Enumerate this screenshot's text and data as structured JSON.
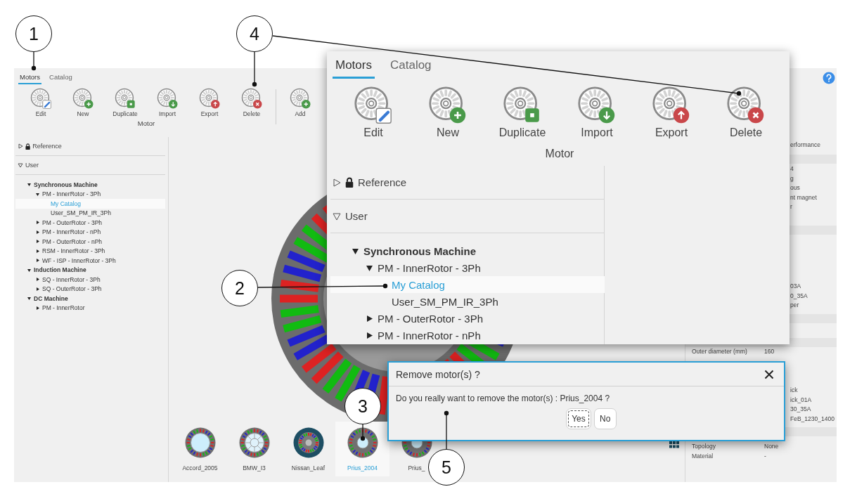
{
  "app": {
    "tabs": [
      {
        "label": "Motors",
        "selected": true
      },
      {
        "label": "Catalog",
        "selected": false
      }
    ],
    "toolbar": [
      {
        "label": "Motor",
        "buttons": [
          {
            "label": "Edit",
            "kind": "edit"
          },
          {
            "label": "New",
            "kind": "new"
          },
          {
            "label": "Duplicate",
            "kind": "duplicate"
          },
          {
            "label": "Import",
            "kind": "import"
          },
          {
            "label": "Export",
            "kind": "export"
          },
          {
            "label": "Delete",
            "kind": "delete"
          }
        ]
      },
      {
        "buttons": [
          {
            "label": "Add",
            "kind": "add"
          }
        ]
      }
    ],
    "tree": [
      {
        "label": "Reference",
        "locked": true,
        "expanded": false
      },
      {
        "label": "User",
        "locked": false,
        "expanded": true,
        "children": [
          {
            "label": "Synchronous Machine",
            "kind": "folder",
            "expanded": true,
            "selected": false,
            "children": [
              {
                "label": "PM - InnerRotor - 3Ph",
                "kind": "folder",
                "expanded": true,
                "selected": false,
                "children": [
                  {
                    "label": "My Catalog",
                    "kind": "leaf",
                    "selected": true
                  },
                  {
                    "label": "User_SM_PM_IR_3Ph",
                    "kind": "leaf",
                    "selected": false
                  }
                ]
              },
              {
                "label": "PM - OuterRotor - 3Ph",
                "kind": "folder",
                "expanded": false,
                "selected": false
              },
              {
                "label": "PM - InnerRotor - nPh",
                "kind": "folder",
                "expanded": false,
                "selected": false
              },
              {
                "label": "PM - OuterRotor - nPh",
                "kind": "folder",
                "expanded": false,
                "selected": false
              },
              {
                "label": "RSM - InnerRotor - 3Ph",
                "kind": "folder",
                "expanded": false,
                "selected": false
              },
              {
                "label": "WF - ISP - InnerRotor - 3Ph",
                "kind": "folder",
                "expanded": false,
                "selected": false
              }
            ]
          },
          {
            "label": "Induction Machine",
            "kind": "folder",
            "expanded": true,
            "selected": false,
            "children": [
              {
                "label": "SQ - InnerRotor - 3Ph",
                "kind": "folder",
                "expanded": false,
                "selected": false
              },
              {
                "label": "SQ - OuterRotor - 3Ph",
                "kind": "folder",
                "expanded": false,
                "selected": false
              }
            ]
          },
          {
            "label": "DC Machine",
            "kind": "folder",
            "expanded": true,
            "selected": false,
            "children": [
              {
                "label": "PM - InnerRotor",
                "kind": "folder",
                "expanded": false,
                "selected": false
              }
            ]
          }
        ]
      }
    ],
    "motors": [
      {
        "name": "Accord_2005",
        "kind": "open-bore",
        "selected": false
      },
      {
        "name": "BMW_I3",
        "kind": "spoked",
        "selected": false
      },
      {
        "name": "Nissan_Leaf",
        "kind": "dark-ring",
        "selected": false
      },
      {
        "name": "Prius_2004",
        "kind": "small-bore",
        "selected": true
      },
      {
        "name": "Prius_",
        "kind": "small-bore",
        "selected": false
      }
    ],
    "properties": [
      {
        "kind": "fragment",
        "text": "erformance"
      },
      {
        "kind": "band"
      },
      {
        "kind": "fragment",
        "text": "4"
      },
      {
        "kind": "fragment",
        "text": "g"
      },
      {
        "kind": "fragment",
        "text": "ous"
      },
      {
        "kind": "fragment",
        "text": "nt magnet"
      },
      {
        "kind": "fragment",
        "text": "r"
      },
      {
        "kind": "band"
      },
      {
        "kind": "fragment",
        "text": "03A"
      },
      {
        "kind": "fragment",
        "text": "0_35A"
      },
      {
        "kind": "fragment",
        "text": "per"
      },
      {
        "kind": "band"
      },
      {
        "kind": "band"
      },
      {
        "kind": "row",
        "label": "Outer diameter (mm)",
        "value": "160"
      },
      {
        "kind": "fragment",
        "text": "ick"
      },
      {
        "kind": "fragment",
        "text": "ick_01A"
      },
      {
        "kind": "fragment",
        "text": "30_35A"
      },
      {
        "kind": "fragment",
        "text": "FeB_1230_1400"
      },
      {
        "kind": "band"
      },
      {
        "kind": "row",
        "label": "Topology",
        "value": "None"
      },
      {
        "kind": "row",
        "label": "Material",
        "value": "-"
      }
    ]
  },
  "zoom_view": {
    "tabs": [
      {
        "label": "Motors",
        "selected": true
      },
      {
        "label": "Catalog",
        "selected": false
      }
    ],
    "toolbar": {
      "label": "Motor",
      "buttons": [
        {
          "label": "Edit",
          "kind": "edit"
        },
        {
          "label": "New",
          "kind": "new"
        },
        {
          "label": "Duplicate",
          "kind": "duplicate"
        },
        {
          "label": "Import",
          "kind": "import"
        },
        {
          "label": "Export",
          "kind": "export"
        },
        {
          "label": "Delete",
          "kind": "delete"
        }
      ]
    },
    "tree": [
      {
        "label": "Reference",
        "locked": true,
        "expanded": false
      },
      {
        "label": "User",
        "locked": false,
        "expanded": true,
        "children": [
          {
            "label": "Synchronous Machine",
            "kind": "folder",
            "expanded": true,
            "selected": false,
            "children": [
              {
                "label": "PM - InnerRotor - 3Ph",
                "kind": "folder",
                "expanded": true,
                "selected": false,
                "children": [
                  {
                    "label": "My Catalog",
                    "kind": "leaf",
                    "selected": true
                  },
                  {
                    "label": "User_SM_PM_IR_3Ph",
                    "kind": "leaf",
                    "selected": false
                  }
                ]
              },
              {
                "label": "PM - OuterRotor - 3Ph",
                "kind": "folder",
                "expanded": false,
                "selected": false
              },
              {
                "label": "PM - InnerRotor - nPh",
                "kind": "folder",
                "expanded": false,
                "selected": false
              }
            ]
          }
        ]
      }
    ]
  },
  "dialog": {
    "title": "Remove motor(s) ?",
    "message": "Do you really want to remove the motor(s) : Prius_2004 ?",
    "buttons": [
      {
        "label": "Yes",
        "focused": true
      },
      {
        "label": "No",
        "focused": false
      }
    ]
  },
  "callouts": [
    {
      "label": "1"
    },
    {
      "label": "4"
    },
    {
      "label": "2"
    },
    {
      "label": "3"
    },
    {
      "label": "5"
    }
  ]
}
